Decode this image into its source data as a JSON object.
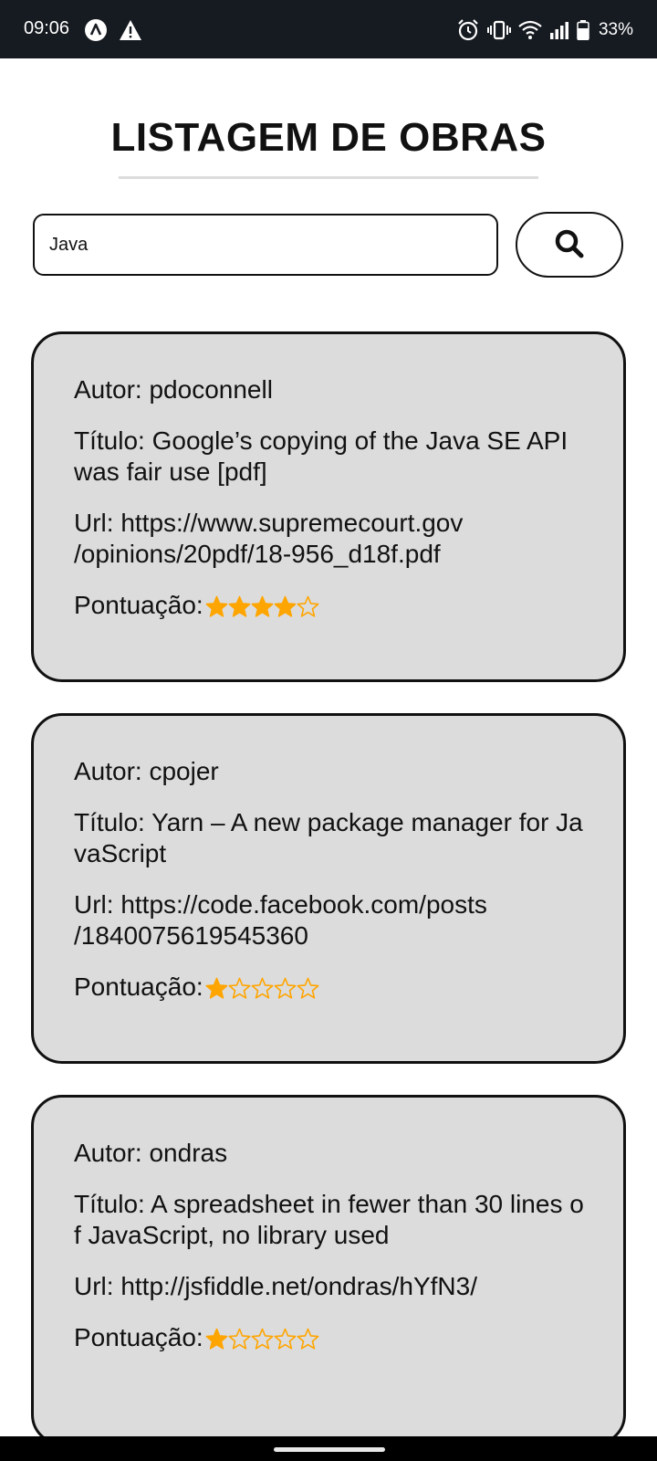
{
  "status_bar": {
    "time": "09:06",
    "battery": "33%"
  },
  "page": {
    "title": "LISTAGEM DE OBRAS"
  },
  "search": {
    "value": "Java"
  },
  "colors": {
    "card_background": "#dcdcdc",
    "star": "#ffa500",
    "status_bar": "#161a21"
  },
  "labels": {
    "author": "Autor: ",
    "title": "Título: ",
    "url": "Url: ",
    "score": "Pontuação:"
  },
  "results": [
    {
      "author": "pdoconnell",
      "title": "Google’s copying of the Java SE API was fair use [pdf]",
      "url_line1": "https://www.supremecourt.gov",
      "url_line2": "/opinions/20pdf/18-956_d18f.pdf",
      "score": 4,
      "score_max": 5
    },
    {
      "author": "cpojer",
      "title": "Yarn – A new package manager for JavaScript",
      "url_line1": "https://code.facebook.com/posts",
      "url_line2": "/1840075619545360",
      "score": 1,
      "score_max": 5
    },
    {
      "author": "ondras",
      "title": "A spreadsheet in fewer than 30 lines of JavaScript, no library used",
      "url_line1": "http://jsfiddle.net/ondras/hYfN3/",
      "url_line2": "",
      "score": 1,
      "score_max": 5
    }
  ]
}
